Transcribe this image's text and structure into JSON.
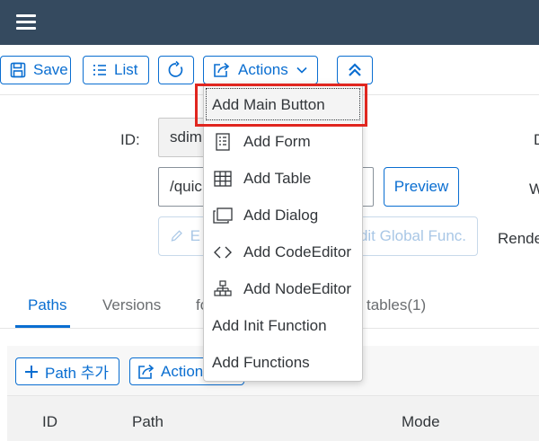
{
  "toolbar": {
    "save_label": "Save",
    "list_label": "List",
    "actions_label": "Actions"
  },
  "form": {
    "id_label": "ID:",
    "id_value": "sdim",
    "path_value": "/quic",
    "edit_button_partial": "E",
    "edit_global_partial": "dit Global Func.",
    "preview_label": "Preview",
    "right_label_d": "D",
    "right_label_w": "W",
    "right_label_rende": "Rende"
  },
  "tabs": [
    {
      "label": "Paths"
    },
    {
      "label": "Versions"
    },
    {
      "label": "fo"
    },
    {
      "label": "tables(1)"
    }
  ],
  "panel": {
    "add_path_label": "Path 추가",
    "actions_partial": "Action"
  },
  "grid": {
    "columns": [
      "ID",
      "Path",
      "Mode"
    ]
  },
  "menu": {
    "items": [
      {
        "label": "Add Main Button",
        "icon": "none"
      },
      {
        "label": "Add Form",
        "icon": "form-icon"
      },
      {
        "label": "Add Table",
        "icon": "table-icon"
      },
      {
        "label": "Add Dialog",
        "icon": "dialog-icon"
      },
      {
        "label": "Add CodeEditor",
        "icon": "code-icon"
      },
      {
        "label": "Add NodeEditor",
        "icon": "hierarchy-icon"
      },
      {
        "label": "Add Init Function",
        "icon": "none"
      },
      {
        "label": "Add Functions",
        "icon": "none"
      }
    ]
  },
  "colors": {
    "shell": "#354a5f",
    "accent": "#0a6ed1",
    "highlight": "#e0261f"
  }
}
